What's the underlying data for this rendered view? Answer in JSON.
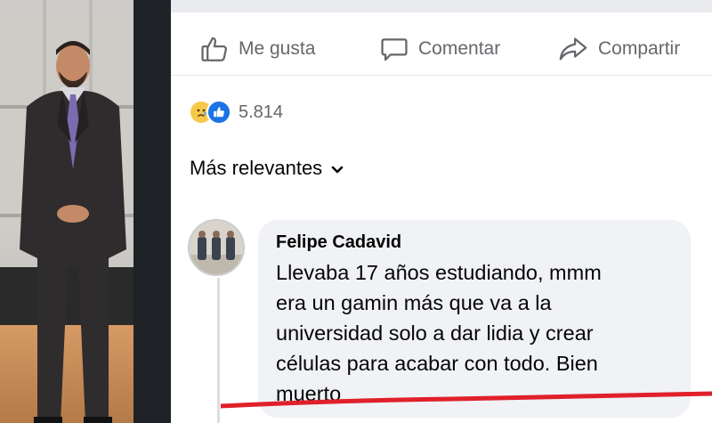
{
  "actions": {
    "like_label": "Me gusta",
    "comment_label": "Comentar",
    "share_label": "Compartir"
  },
  "reactions": {
    "icons": [
      "sad-reaction-icon",
      "like-reaction-icon"
    ],
    "count": "5.814"
  },
  "comments_filter": {
    "label": "Más relevantes"
  },
  "comment": {
    "author": "Felipe Cadavid",
    "lines": [
      "Llevaba 17 años estudiando, mmm",
      "era un gamin más que va a la",
      "universidad solo a dar lidia y crear",
      "células para acabar con todo. Bien",
      "muerto"
    ]
  },
  "colors": {
    "accent": "#1b74e4",
    "muted_text": "#65676b",
    "bubble": "#f0f2f5",
    "annotation_red": "#e0202a"
  }
}
